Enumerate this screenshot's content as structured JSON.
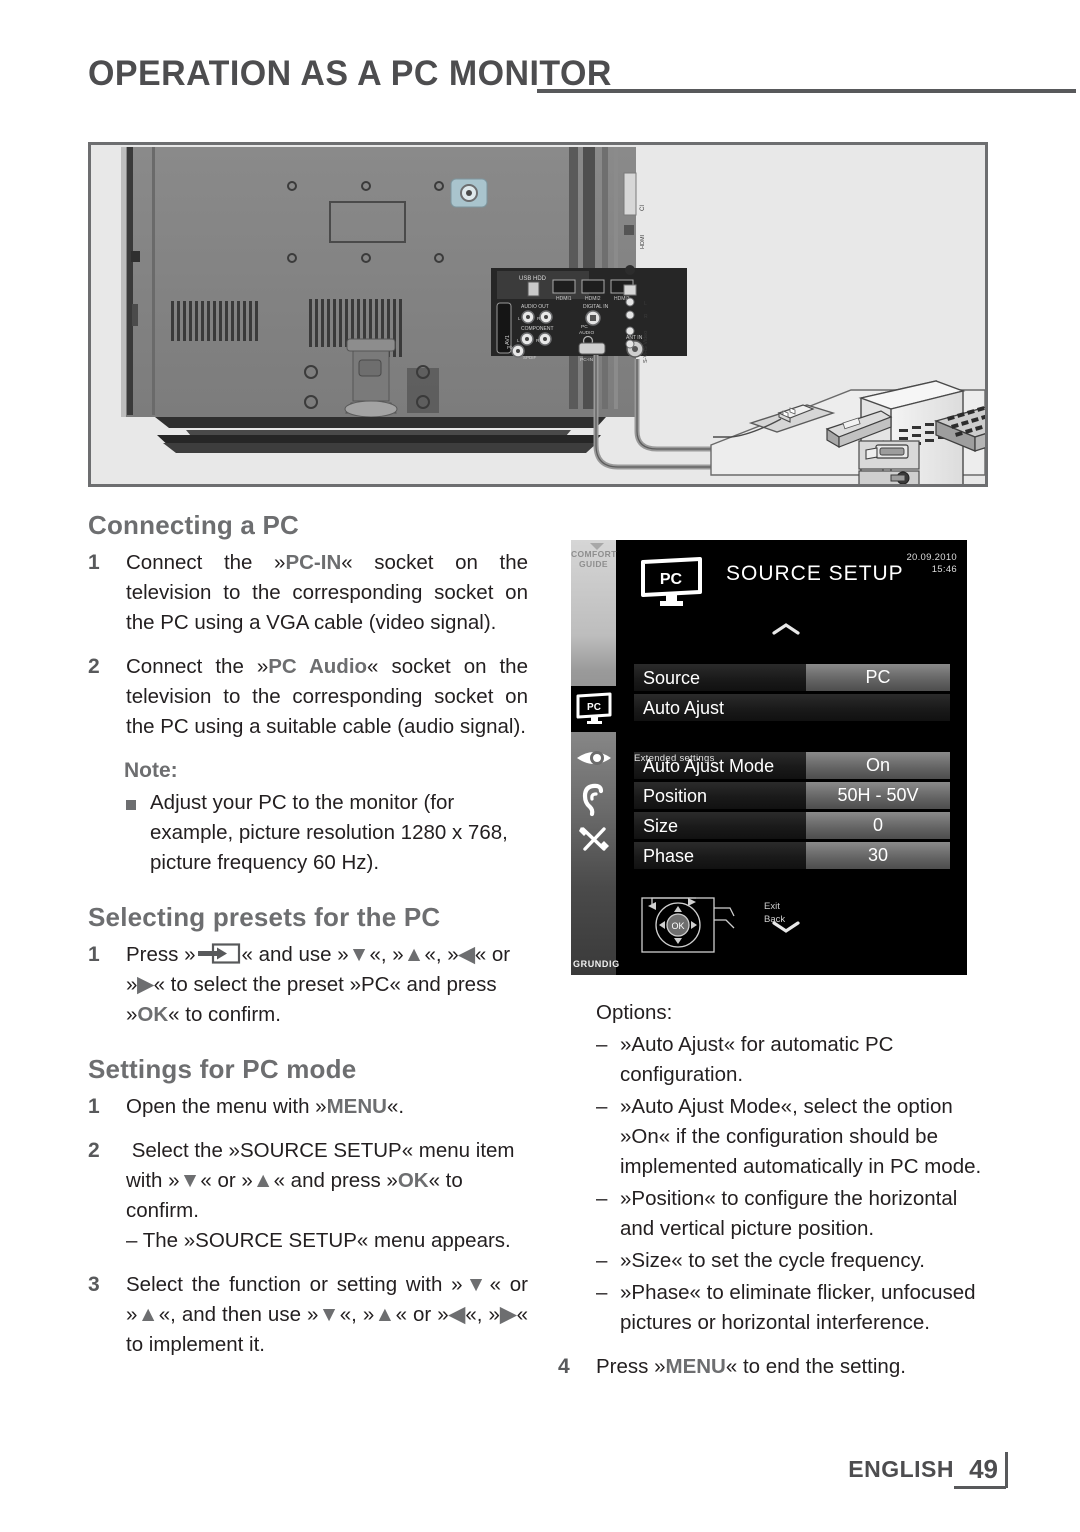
{
  "header": {
    "title": "OPERATION AS A PC MONITOR",
    "rule": "horizontal-rule"
  },
  "illustration": {
    "name": "tv-rear-panel-connected-to-pc",
    "labels": {
      "usb_hdd": "USB HDD",
      "hdmi1": "HDMI1",
      "hdmi2": "HDMI2",
      "hdmi3": "HDMI3",
      "audio_out": "AUDIO OUT",
      "digital_in": "DIGITAL IN",
      "component": "COMPONENT",
      "pc_audio": "PC AUDIO",
      "pc_in": "PC-IN",
      "ant_in": "ANT IN",
      "av1": "AV1",
      "spdif": "SPDIF",
      "side_ci": "CI",
      "side_hdmi": "HDMI",
      "side_av": "S-VHS Video",
      "side_l": "L",
      "side_r": "R"
    }
  },
  "left_column": {
    "connecting": {
      "heading": "Connecting a PC",
      "steps": [
        {
          "num": "1",
          "parts": [
            {
              "t": "Connect the »"
            },
            {
              "t": "PC-IN",
              "bold": true
            },
            {
              "t": "« socket on the television to the corresponding socket on the PC using a VGA cable (video signal)."
            }
          ]
        },
        {
          "num": "2",
          "parts": [
            {
              "t": "Connect the »"
            },
            {
              "t": "PC Audio",
              "bold": true
            },
            {
              "t": "« socket on the television to the corresponding socket on the PC using a suitable cable (audio signal)."
            }
          ]
        }
      ],
      "note_heading": "Note:",
      "note_text": "Adjust your PC to the monitor (for example, picture resolution 1280 x 768, picture frequency 60 Hz)."
    },
    "presets": {
      "heading": "Selecting presets for the PC",
      "step_num": "1",
      "step_pre": "Press »",
      "step_icon": "source-select-icon",
      "step_post_a": "« and use »",
      "glyph_down": "∨",
      "glyph_up": "∧",
      "glyph_left": "‹",
      "glyph_right": "›",
      "step_tail": "to select the preset »PC« and press »OK« to confirm."
    },
    "settings": {
      "heading": "Settings for PC mode",
      "step1_num": "1",
      "step1_text": "Open the menu with »MENU«.",
      "step1_kb": "MENU",
      "step2_num": "2",
      "step2_text": "Select the »SOURCE SETUP« menu item with »∨« or »∧« and press »OK« to confirm.",
      "step2_sub": "– The »SOURCE SETUP« menu appears.",
      "step3_num": "3",
      "step3_text": "Select the function or setting with »∨« or »∧«, and then use »∨«, »∧« or »‹«, »›« to implement it."
    }
  },
  "osd": {
    "brand": "GRUNDIG",
    "comfort_guide": "COMFORT\nGUIDE",
    "comfort_line1": "COMFORT",
    "comfort_line2": "GUIDE",
    "title": "SOURCE SETUP",
    "date": "20.09.2010",
    "time": "15:46",
    "scroll_up": "⌃",
    "scroll_down": "⌄",
    "extended_label": "Extended settings",
    "rail_icons": [
      {
        "name": "pc-monitor-icon",
        "label": "PC",
        "selected": true
      },
      {
        "name": "eye-picture-icon",
        "label": "",
        "selected": false
      },
      {
        "name": "ear-sound-icon",
        "label": "",
        "selected": false
      },
      {
        "name": "tools-settings-icon",
        "label": "",
        "selected": false
      }
    ],
    "rows": [
      {
        "label": "Source",
        "value": "PC",
        "has_value": true
      },
      {
        "label": "Auto Ajust",
        "value": "",
        "has_value": false
      },
      {
        "label": "Auto Ajust Mode",
        "value": "On",
        "has_value": true
      },
      {
        "label": "Position",
        "value": "50H - 50V",
        "has_value": true
      },
      {
        "label": "Size",
        "value": "0",
        "has_value": true
      },
      {
        "label": "Phase",
        "value": "30",
        "has_value": true
      }
    ],
    "nav_exit": "Exit",
    "nav_back": "Back",
    "nav_ok": "OK"
  },
  "right_column": {
    "options_label": "Options:",
    "options": [
      "»Auto Ajust« for automatic PC configuration.",
      "»Auto Ajust Mode«, select the option »On« if the configuration should be implemented automatically in PC mode.",
      "»Position« to configure the horizontal and vertical picture position.",
      "»Size« to set the cycle frequency.",
      "»Phase« to eliminate flicker, unfocused pictures or horizontal interference."
    ],
    "final_step_num": "4",
    "final_step_pre": "Press »",
    "final_step_kb": "MENU",
    "final_step_post": "« to end the setting."
  },
  "footer": {
    "language": "ENGLISH",
    "page": "49"
  },
  "colors": {
    "heading_gray": "#6d6e70",
    "rule_gray": "#58595b",
    "body_black": "#231f20",
    "illustration_bg": "#e8e8e8",
    "osd_bg": "#000000",
    "osd_value_gray": "#6f6f6f"
  }
}
